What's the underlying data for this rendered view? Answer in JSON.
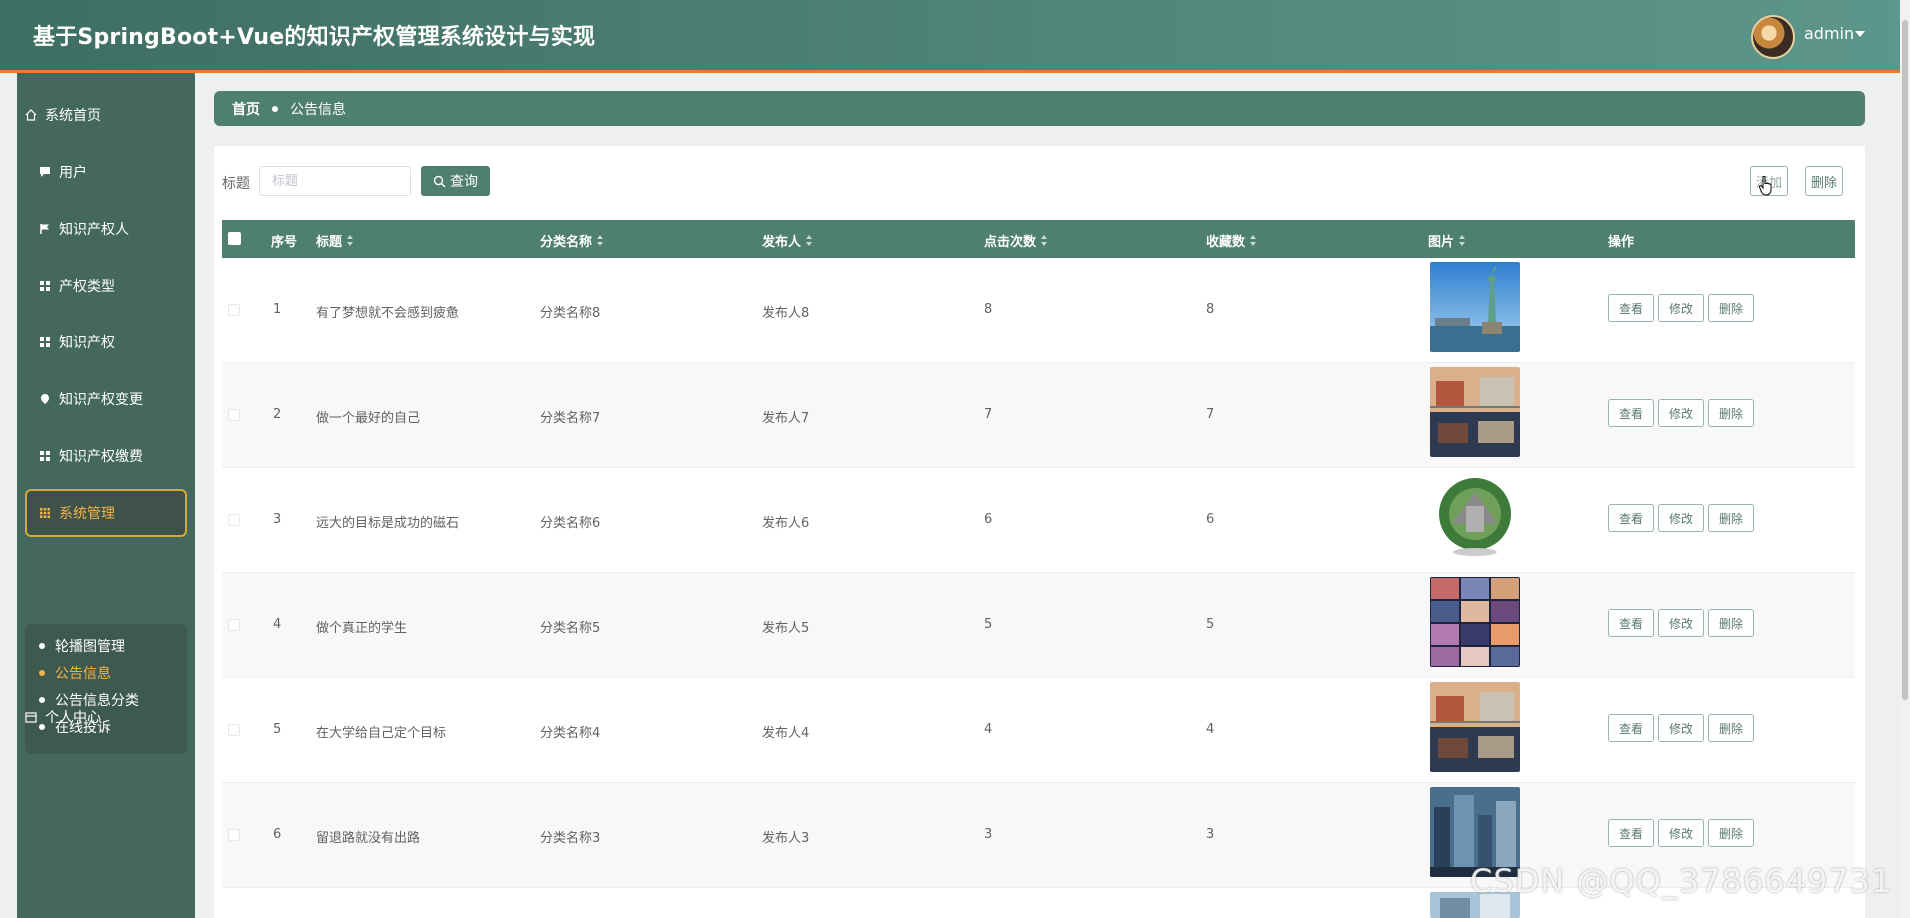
{
  "header": {
    "title": "基于SpringBoot+Vue的知识产权管理系统设计与实现",
    "username": "admin"
  },
  "sidebar": {
    "items": [
      {
        "label": "系统首页",
        "icon": "home-icon"
      },
      {
        "label": "用户",
        "icon": "chat-icon"
      },
      {
        "label": "知识产权人",
        "icon": "flag-icon"
      },
      {
        "label": "产权类型",
        "icon": "grid-icon"
      },
      {
        "label": "知识产权",
        "icon": "grid-icon"
      },
      {
        "label": "知识产权变更",
        "icon": "pin-icon"
      },
      {
        "label": "知识产权缴费",
        "icon": "grid-icon"
      },
      {
        "label": "系统管理",
        "icon": "apps-icon",
        "active": true
      },
      {
        "label": "个人中心",
        "icon": "calendar-icon"
      }
    ],
    "submenu": [
      {
        "label": "轮播图管理"
      },
      {
        "label": "公告信息",
        "active": true
      },
      {
        "label": "公告信息分类"
      },
      {
        "label": "在线投诉"
      }
    ]
  },
  "breadcrumb": {
    "home": "首页",
    "current": "公告信息"
  },
  "search": {
    "label": "标题",
    "placeholder": "标题",
    "button": "查询"
  },
  "toolbar": {
    "add": "添加",
    "delete": "删除"
  },
  "table": {
    "headers": [
      "序号",
      "标题",
      "分类名称",
      "发布人",
      "点击次数",
      "收藏数",
      "图片",
      "操作"
    ],
    "rows": [
      {
        "index": "1",
        "title": "有了梦想就不会感到疲惫",
        "category": "分类名称8",
        "publisher": "发布人8",
        "clicks": "8",
        "favorites": "8",
        "image": "statue-of-liberty"
      },
      {
        "index": "2",
        "title": "做一个最好的自己",
        "category": "分类名称7",
        "publisher": "发布人7",
        "clicks": "7",
        "favorites": "7",
        "image": "street-buildings"
      },
      {
        "index": "3",
        "title": "远大的目标是成功的磁石",
        "category": "分类名称6",
        "publisher": "发布人6",
        "clicks": "6",
        "favorites": "6",
        "image": "globe-city"
      },
      {
        "index": "4",
        "title": "做个真正的学生",
        "category": "分类名称5",
        "publisher": "发布人5",
        "clicks": "5",
        "favorites": "5",
        "image": "photo-collage"
      },
      {
        "index": "5",
        "title": "在大学给自己定个目标",
        "category": "分类名称4",
        "publisher": "发布人4",
        "clicks": "4",
        "favorites": "4",
        "image": "street-buildings"
      },
      {
        "index": "6",
        "title": "留退路就没有出路",
        "category": "分类名称3",
        "publisher": "发布人3",
        "clicks": "3",
        "favorites": "3",
        "image": "city-towers"
      }
    ],
    "actions": {
      "view": "查看",
      "edit": "修改",
      "delete": "删除"
    }
  },
  "watermark": "CSDN @QQ_3786649731",
  "colors": {
    "primary": "#4f7f70",
    "sidebar": "#44695c",
    "accent": "#f2b24a",
    "header_border": "#f07a20"
  }
}
